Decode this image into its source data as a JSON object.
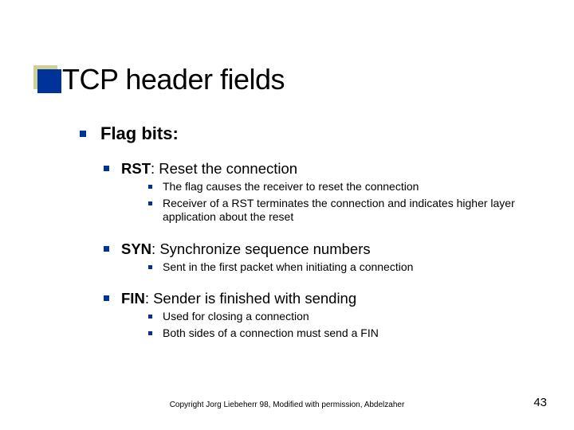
{
  "title": "TCP header fields",
  "body": {
    "heading": "Flag bits:",
    "items": [
      {
        "code": "RST",
        "label": ": Reset the connection",
        "sub": [
          "The flag causes the receiver to reset the connection",
          "Receiver of a RST terminates the connection and indicates higher layer application about the reset"
        ]
      },
      {
        "code": "SYN",
        "label": ": Synchronize sequence numbers",
        "sub": [
          "Sent in the first packet when initiating a connection"
        ]
      },
      {
        "code": "FIN",
        "label": ": Sender is finished with sending",
        "sub": [
          "Used for closing a connection",
          "Both sides of a connection must send a FIN"
        ]
      }
    ]
  },
  "footer": {
    "copyright": "Copyright Jorg Liebeherr 98, Modified with permission, Abdelzaher",
    "page": "43"
  }
}
